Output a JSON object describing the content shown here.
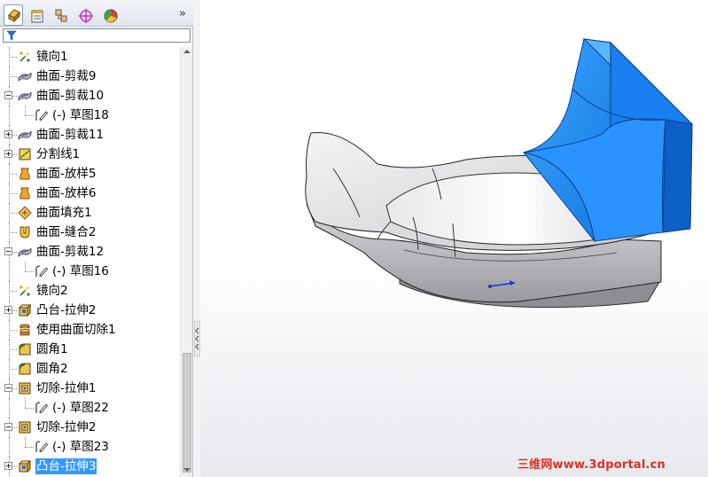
{
  "tabs": [
    {
      "icon": "feature-manager-icon",
      "active": true
    },
    {
      "icon": "property-manager-icon",
      "active": false
    },
    {
      "icon": "configuration-manager-icon",
      "active": false
    },
    {
      "icon": "dimxpert-icon",
      "active": false
    },
    {
      "icon": "display-manager-icon",
      "active": false
    }
  ],
  "more_label": "»",
  "filter": {
    "icon": "filter-icon",
    "value": ""
  },
  "tree": [
    {
      "label": "镜向1",
      "icon": "mirror-icon",
      "expandable": false,
      "selected": false
    },
    {
      "label": "曲面-剪裁9",
      "icon": "surface-trim-icon",
      "expandable": false,
      "selected": false
    },
    {
      "label": "曲面-剪裁10",
      "icon": "surface-trim-icon",
      "expandable": true,
      "expanded": true,
      "selected": false
    },
    {
      "label": "(-) 草图18",
      "icon": "sketch-icon",
      "expandable": false,
      "selected": false
    },
    {
      "label": "曲面-剪裁11",
      "icon": "surface-trim-icon",
      "expandable": true,
      "expanded": false,
      "selected": false
    },
    {
      "label": "分割线1",
      "icon": "split-line-icon",
      "expandable": true,
      "expanded": false,
      "selected": false
    },
    {
      "label": "曲面-放样5",
      "icon": "surface-loft-icon",
      "expandable": false,
      "selected": false
    },
    {
      "label": "曲面-放样6",
      "icon": "surface-loft-icon",
      "expandable": false,
      "selected": false
    },
    {
      "label": "曲面填充1",
      "icon": "surface-fill-icon",
      "expandable": false,
      "selected": false
    },
    {
      "label": "曲面-缝合2",
      "icon": "surface-knit-icon",
      "expandable": false,
      "selected": false
    },
    {
      "label": "曲面-剪裁12",
      "icon": "surface-trim-icon",
      "expandable": true,
      "expanded": true,
      "selected": false
    },
    {
      "label": "(-) 草图16",
      "icon": "sketch-icon",
      "expandable": false,
      "selected": false
    },
    {
      "label": "镜向2",
      "icon": "mirror-icon",
      "expandable": false,
      "selected": false
    },
    {
      "label": "凸台-拉伸2",
      "icon": "boss-extrude-icon",
      "expandable": true,
      "expanded": false,
      "selected": false
    },
    {
      "label": "使用曲面切除1",
      "icon": "surface-cut-icon",
      "expandable": false,
      "selected": false
    },
    {
      "label": "圆角1",
      "icon": "fillet-icon",
      "expandable": false,
      "selected": false
    },
    {
      "label": "圆角2",
      "icon": "fillet-icon",
      "expandable": false,
      "selected": false
    },
    {
      "label": "切除-拉伸1",
      "icon": "cut-extrude-icon",
      "expandable": true,
      "expanded": true,
      "selected": false
    },
    {
      "label": "(-) 草图22",
      "icon": "sketch-icon",
      "expandable": false,
      "selected": false
    },
    {
      "label": "切除-拉伸2",
      "icon": "cut-extrude-icon",
      "expandable": true,
      "expanded": true,
      "selected": false
    },
    {
      "label": "(-) 草图23",
      "icon": "sketch-icon",
      "expandable": false,
      "selected": false
    },
    {
      "label": "凸台-拉伸3",
      "icon": "boss-extrude-icon",
      "expandable": true,
      "expanded": false,
      "selected": true
    }
  ],
  "watermark": "三维网www.3dportal.cn",
  "colors": {
    "selection": "#3399ff",
    "highlight_face": "#1e90ff",
    "model_gray": "#c8c8cc"
  }
}
